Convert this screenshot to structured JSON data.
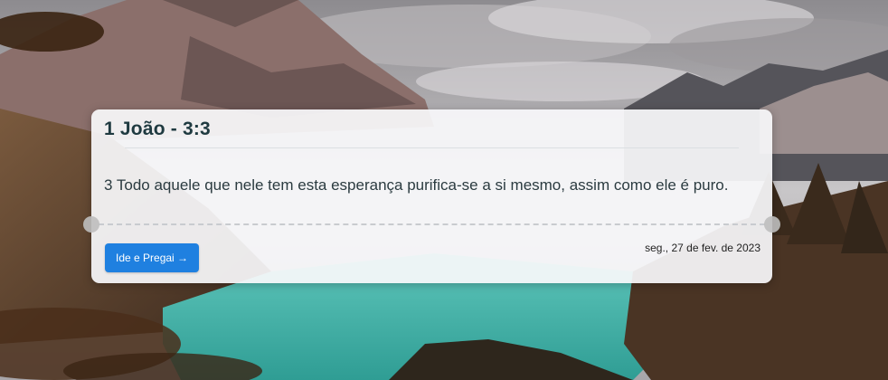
{
  "card": {
    "title": "1 João - 3:3",
    "verse": "3 Todo aquele que nele tem esta esperança purifica-se a si mesmo, assim como ele é puro.",
    "button_label": "Ide e Pregai →",
    "date": "seg., 27 de fev. de 2023"
  },
  "colors": {
    "button": "#1f80e0",
    "title_text": "#1f3a40",
    "lake": "#3aa8a0"
  },
  "background": {
    "icon": "mountain-lake-landscape"
  }
}
